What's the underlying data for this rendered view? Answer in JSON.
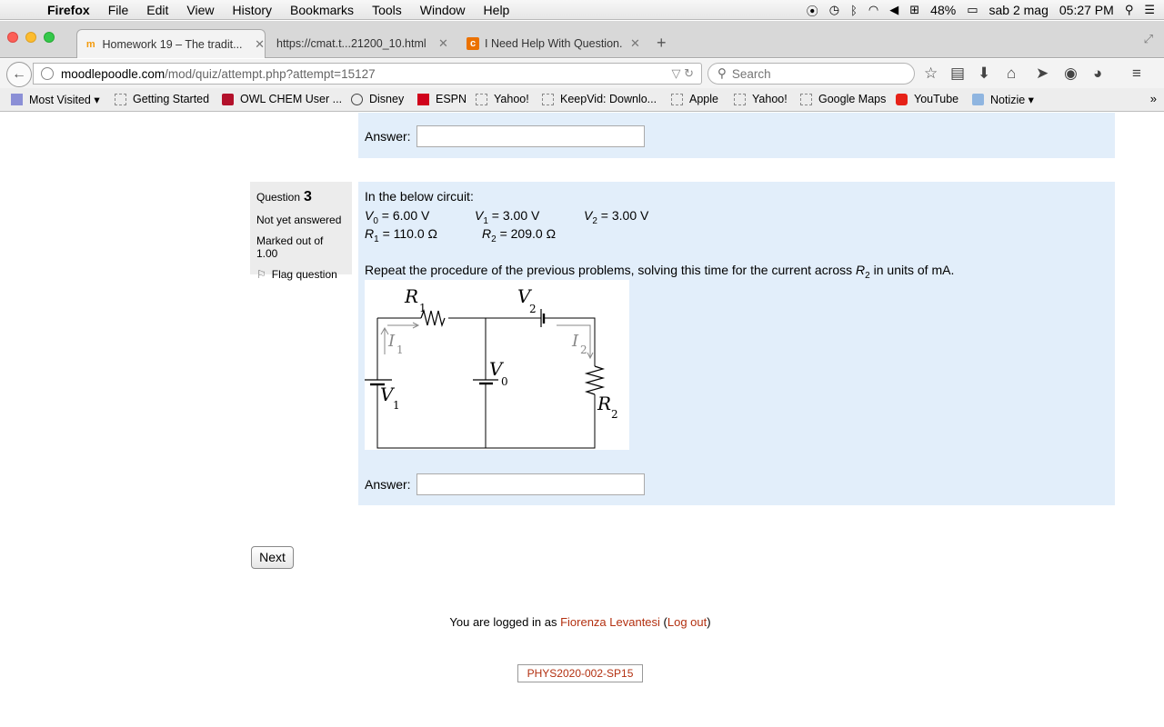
{
  "menubar": {
    "app": "Firefox",
    "items": [
      "File",
      "Edit",
      "View",
      "History",
      "Bookmarks",
      "Tools",
      "Window",
      "Help"
    ],
    "battery": "48%",
    "date": "sab 2 mag",
    "time": "05:27 PM"
  },
  "tabs": [
    {
      "title": "Homework 19 – The tradit...",
      "icon": "moodle-icon",
      "active": true
    },
    {
      "title": "https://cmat.t...21200_10.html",
      "icon": "",
      "active": false
    },
    {
      "title": "I Need Help With Question...",
      "icon": "chegg-icon",
      "active": false
    }
  ],
  "urlbar": {
    "host": "moodlepoodle.com",
    "path": "/mod/quiz/attempt.php?attempt=15127"
  },
  "search": {
    "placeholder": "Search"
  },
  "bookmarks": [
    {
      "label": "Most Visited ▾",
      "icon": "most-visited-icon"
    },
    {
      "label": "Getting Started",
      "icon": "page-icon"
    },
    {
      "label": "OWL CHEM User ...",
      "icon": "owl-icon"
    },
    {
      "label": "Disney",
      "icon": "disney-icon"
    },
    {
      "label": "ESPN",
      "icon": "espn-icon"
    },
    {
      "label": "Yahoo!",
      "icon": "page-icon"
    },
    {
      "label": "KeepVid: Downlo...",
      "icon": "page-icon"
    },
    {
      "label": "Apple",
      "icon": "page-icon"
    },
    {
      "label": "Yahoo!",
      "icon": "page-icon"
    },
    {
      "label": "Google Maps",
      "icon": "page-icon"
    },
    {
      "label": "YouTube",
      "icon": "youtube-icon"
    },
    {
      "label": "Notizie ▾",
      "icon": "folder-icon"
    }
  ],
  "prev_question": {
    "answer_label": "Answer:",
    "answer_value": ""
  },
  "question": {
    "label": "Question",
    "number": "3",
    "status": "Not yet answered",
    "marks": "Marked out of 1.00",
    "flag": "Flag question",
    "intro": "In the below circuit:",
    "v0": "= 6.00 V",
    "v1": "= 3.00 V",
    "v2": "= 3.00 V",
    "r1": "= 110.0 Ω",
    "r2": "= 209.0 Ω",
    "prompt_start": "Repeat the procedure of the previous problems, solving this time for the current across ",
    "prompt_end": " in units of mA.",
    "answer_label": "Answer:",
    "answer_value": ""
  },
  "next_label": "Next",
  "footer": {
    "logged_in_prefix": "You are logged in as ",
    "user": "Fiorenza Levantesi",
    "logout": "Log out",
    "course": "PHYS2020-002-SP15"
  }
}
